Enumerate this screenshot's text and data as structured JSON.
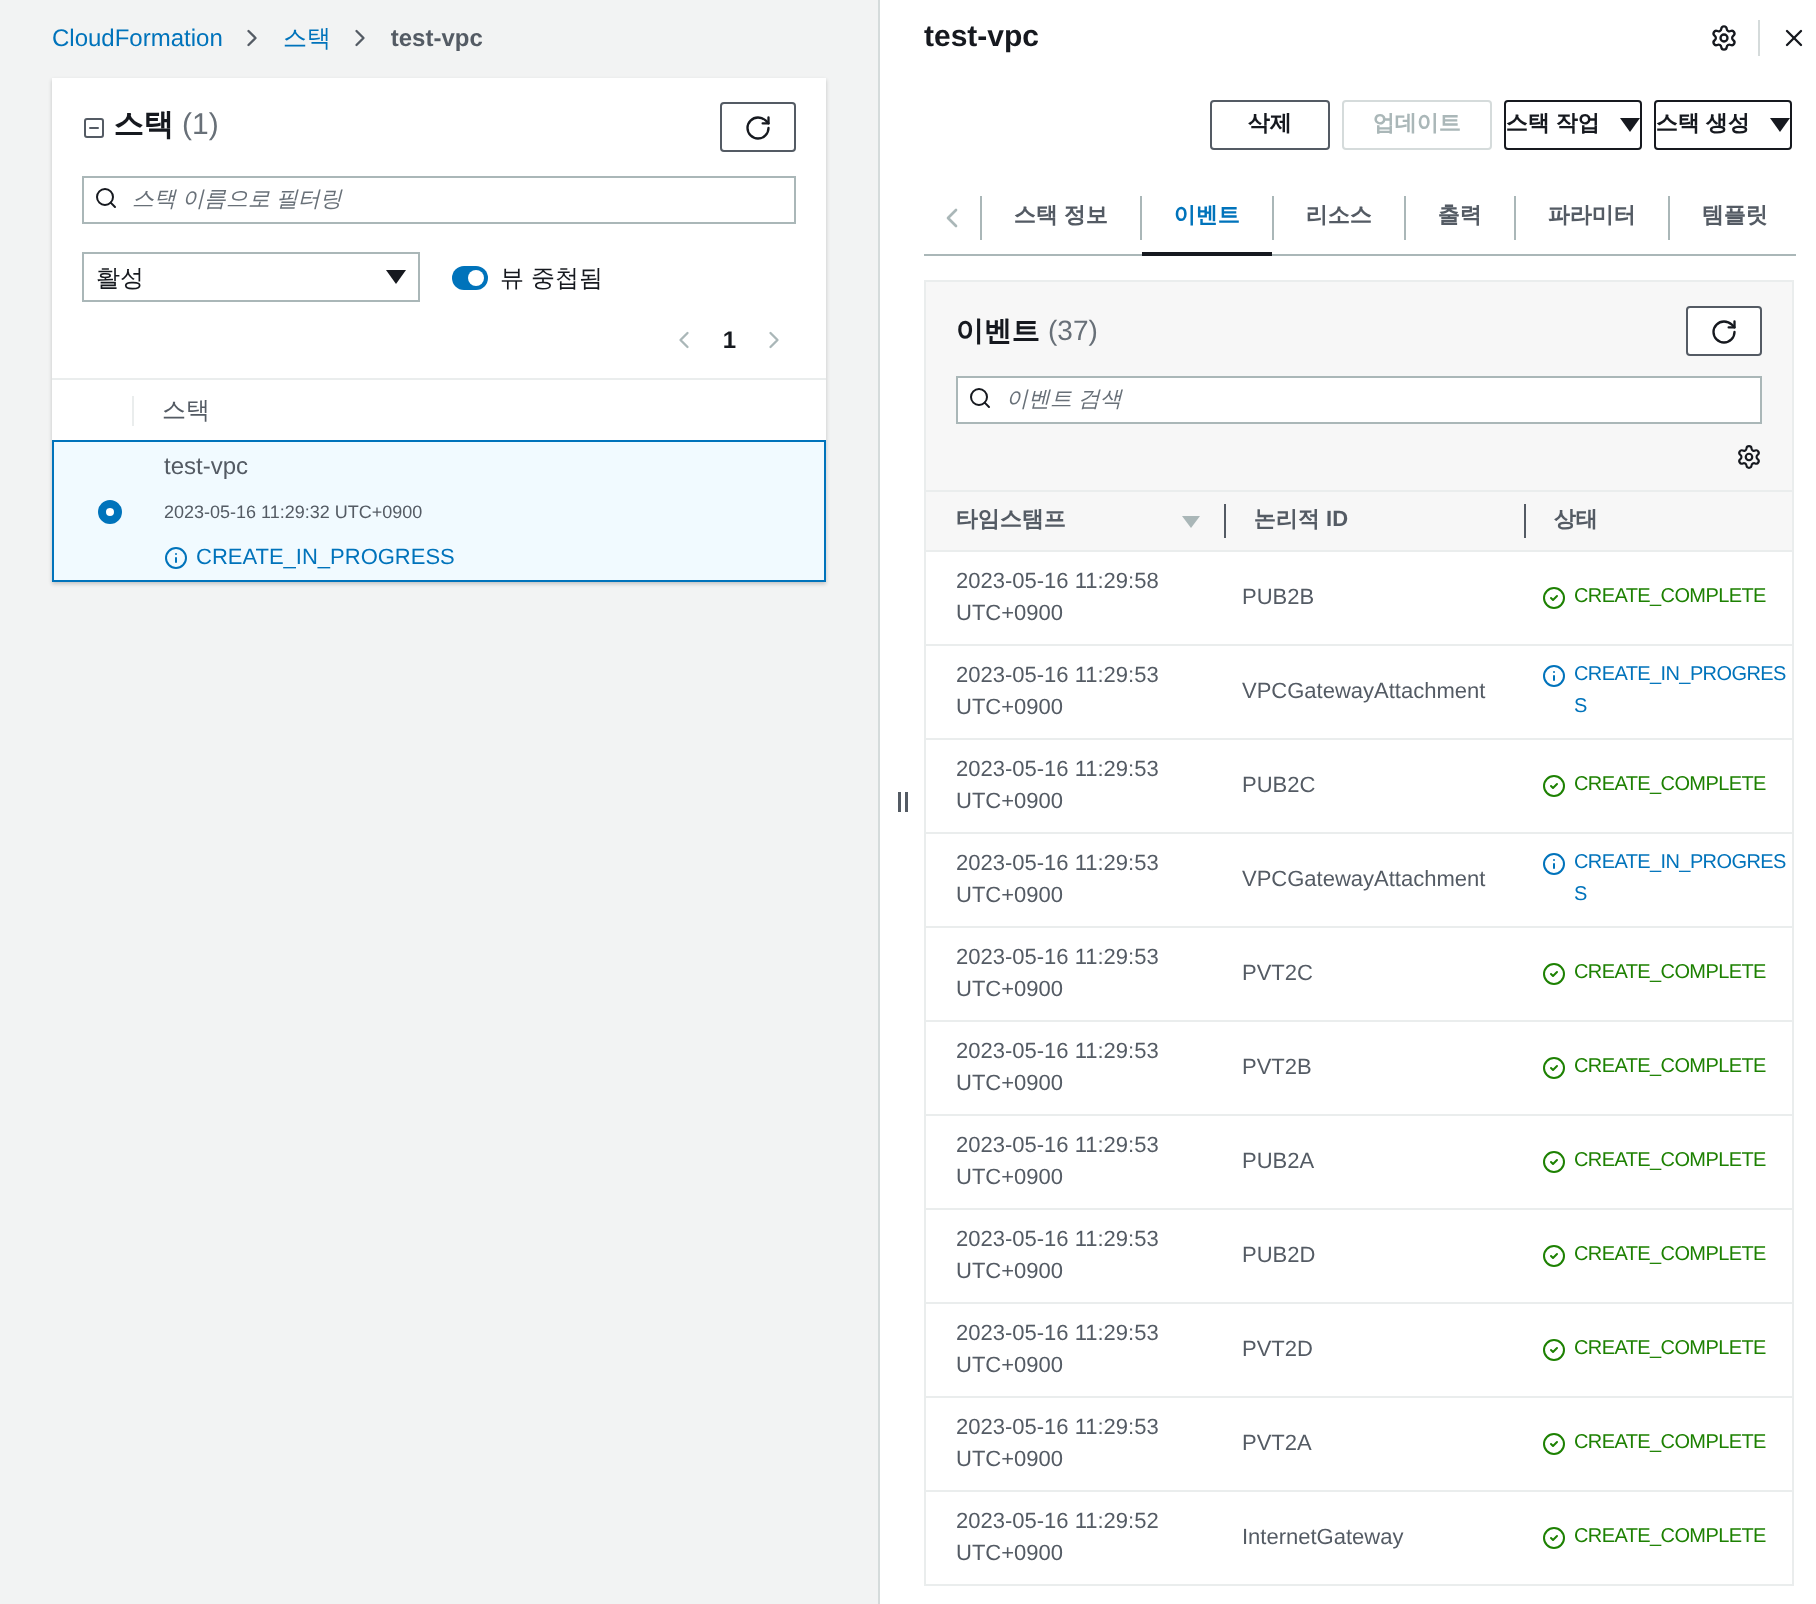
{
  "breadcrumb": [
    {
      "label": "CloudFormation",
      "link": true
    },
    {
      "label": "스택",
      "link": true
    },
    {
      "label": "test-vpc",
      "link": false
    }
  ],
  "stacks_panel": {
    "title": "스택",
    "count": "(1)",
    "filter_placeholder": "스택 이름으로 필터링",
    "status_filter": "활성",
    "toggle": {
      "label": "뷰 중첩됨",
      "on": true
    },
    "page": "1",
    "column": "스택",
    "rows": [
      {
        "name": "test-vpc",
        "time": "2023-05-16 11:29:32 UTC+0900",
        "status": "CREATE_IN_PROGRESS",
        "kind": "progress",
        "selected": true
      }
    ]
  },
  "detail": {
    "title": "test-vpc",
    "buttons": [
      {
        "label": "삭제",
        "disabled": false,
        "dropdown": false
      },
      {
        "label": "업데이트",
        "disabled": true,
        "dropdown": false
      },
      {
        "label": "스택 작업",
        "disabled": false,
        "dropdown": true
      },
      {
        "label": "스택 생성",
        "disabled": false,
        "dropdown": true
      }
    ],
    "tabs": [
      {
        "label": "스택 정보",
        "selected": false
      },
      {
        "label": "이벤트",
        "selected": true
      },
      {
        "label": "리소스",
        "selected": false
      },
      {
        "label": "출력",
        "selected": false
      },
      {
        "label": "파라미터",
        "selected": false
      },
      {
        "label": "템플릿",
        "selected": false
      }
    ],
    "events": {
      "title": "이벤트",
      "count": "(37)",
      "search_placeholder": "이벤트 검색",
      "columns": [
        "타임스탬프",
        "논리적 ID",
        "상태"
      ],
      "rows": [
        {
          "date": "2023-05-16 11:29:58",
          "zone": "UTC+0900",
          "id": "PUB2B",
          "status": "CREATE_COMPLETE",
          "kind": "complete"
        },
        {
          "date": "2023-05-16 11:29:53",
          "zone": "UTC+0900",
          "id": "VPCGatewayAttachment",
          "status": "CREATE_IN_PROGRESS",
          "kind": "progress"
        },
        {
          "date": "2023-05-16 11:29:53",
          "zone": "UTC+0900",
          "id": "PUB2C",
          "status": "CREATE_COMPLETE",
          "kind": "complete"
        },
        {
          "date": "2023-05-16 11:29:53",
          "zone": "UTC+0900",
          "id": "VPCGatewayAttachment",
          "status": "CREATE_IN_PROGRESS",
          "kind": "progress"
        },
        {
          "date": "2023-05-16 11:29:53",
          "zone": "UTC+0900",
          "id": "PVT2C",
          "status": "CREATE_COMPLETE",
          "kind": "complete"
        },
        {
          "date": "2023-05-16 11:29:53",
          "zone": "UTC+0900",
          "id": "PVT2B",
          "status": "CREATE_COMPLETE",
          "kind": "complete"
        },
        {
          "date": "2023-05-16 11:29:53",
          "zone": "UTC+0900",
          "id": "PUB2A",
          "status": "CREATE_COMPLETE",
          "kind": "complete"
        },
        {
          "date": "2023-05-16 11:29:53",
          "zone": "UTC+0900",
          "id": "PUB2D",
          "status": "CREATE_COMPLETE",
          "kind": "complete"
        },
        {
          "date": "2023-05-16 11:29:53",
          "zone": "UTC+0900",
          "id": "PVT2D",
          "status": "CREATE_COMPLETE",
          "kind": "complete"
        },
        {
          "date": "2023-05-16 11:29:53",
          "zone": "UTC+0900",
          "id": "PVT2A",
          "status": "CREATE_COMPLETE",
          "kind": "complete"
        },
        {
          "date": "2023-05-16 11:29:52",
          "zone": "UTC+0900",
          "id": "InternetGateway",
          "status": "CREATE_COMPLETE",
          "kind": "complete"
        }
      ]
    }
  }
}
